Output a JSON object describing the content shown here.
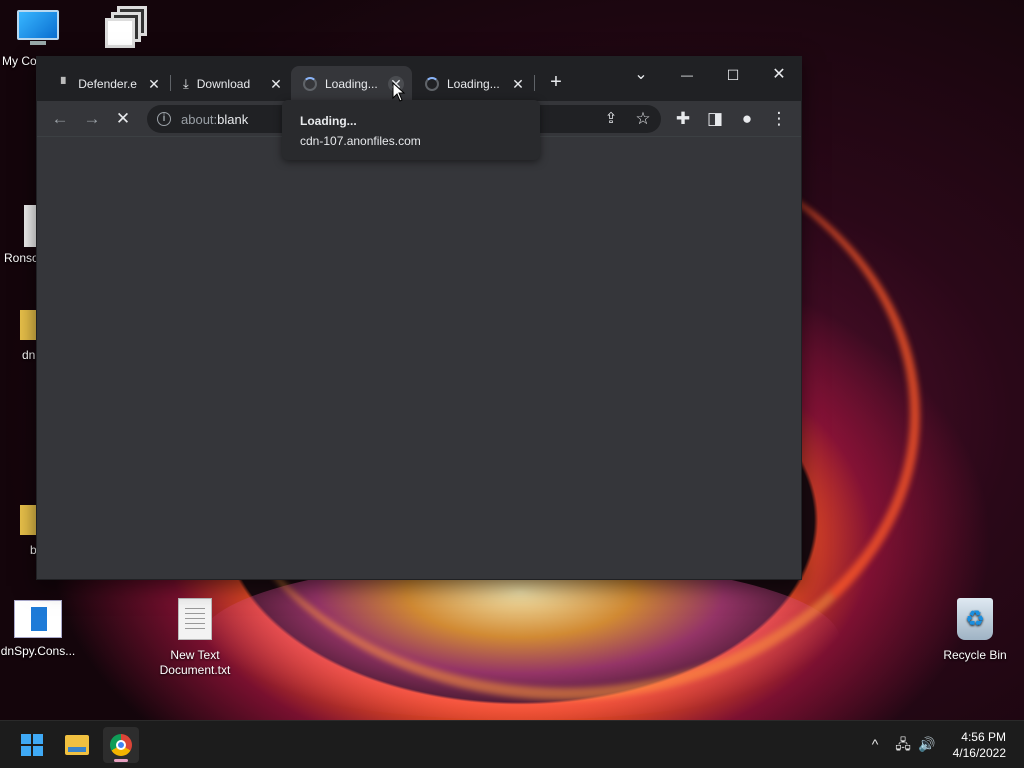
{
  "desktop": {
    "icons": [
      {
        "label": "My Co",
        "icon": "monitor-icon"
      },
      {
        "label": "",
        "icon": "window-stack-icon"
      },
      {
        "label": "Ronso",
        "icon": "file-icon"
      },
      {
        "label": "dn",
        "icon": "folder-icon"
      },
      {
        "label": "b",
        "icon": "folder-icon"
      },
      {
        "label": "dnSpy.Cons...",
        "icon": "dnspy-icon"
      },
      {
        "label": "New Text Document.txt",
        "icon": "text-file-icon"
      },
      {
        "label": "Recycle Bin",
        "icon": "recycle-bin-icon"
      }
    ]
  },
  "browser": {
    "tabs": [
      {
        "title": "Defender.e",
        "icon": "app-icon",
        "close": "✕"
      },
      {
        "title": "Download",
        "icon": "download-icon",
        "close": "✕"
      },
      {
        "title": "Loading...",
        "icon": "spinner-icon",
        "close": "✕",
        "active": true
      },
      {
        "title": "Loading...",
        "icon": "spinner-icon",
        "close": "✕"
      }
    ],
    "new_tab": "+",
    "window_controls": {
      "tab_search": "⌄",
      "minimize": "—",
      "maximize": "☐",
      "close": "✕"
    },
    "toolbar": {
      "back": "←",
      "forward": "→",
      "stop": "✕",
      "url_scheme": "about:",
      "url_host": "blank",
      "info": "i",
      "share": "⇪",
      "bookmark": "☆",
      "extensions": "✚",
      "side_panel": "◨",
      "profile": "●",
      "menu": "⋮"
    },
    "tab_tooltip": {
      "title": "Loading...",
      "host": "cdn-107.anonfiles.com"
    }
  },
  "taskbar": {
    "tray": {
      "chevron": "^",
      "network": "🖧",
      "volume": "🔊"
    },
    "clock": {
      "time": "4:56 PM",
      "date": "4/16/2022"
    }
  }
}
